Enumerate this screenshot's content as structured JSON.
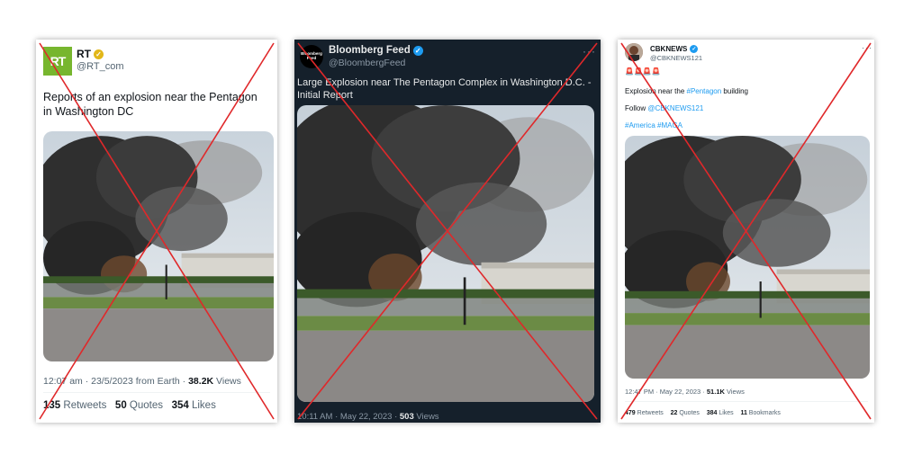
{
  "rt": {
    "name": "RT",
    "handle": "@RT_com",
    "logo_text": "RT",
    "text": "Reports of an explosion near the Pentagon in Washington DC",
    "time_date": "12:07 am · 23/5/2023 from Earth · ",
    "views_count": "38.2K",
    "views_label": " Views",
    "retweets_count": "135",
    "retweets_label": " Retweets",
    "quotes_count": "50",
    "quotes_label": " Quotes",
    "likes_count": "354",
    "likes_label": " Likes",
    "verified_color": "#e2b719"
  },
  "bloomberg": {
    "name": "Bloomberg Feed",
    "handle": "@BloombergFeed",
    "avatar_text": "Bloomberg Feed",
    "more": "···",
    "text": "Large Explosion near The Pentagon Complex in Washington D.C. - Initial Report",
    "time_date": "10:11 AM · May 22, 2023 · ",
    "views_count": "503",
    "views_label": " Views",
    "verified_color": "#1d9bf0"
  },
  "cbk": {
    "name": "CBKNEWS",
    "handle": "@CBKNEWS121",
    "more": "···",
    "emoji_row": "🚨🚨🚨🚨",
    "line1_prefix": "Explosion near the ",
    "line1_tag": "#Pentagon",
    "line1_suffix": " building",
    "line2_prefix": "Follow ",
    "line2_mention": "@CBKNEWS121",
    "line3_tags": "#America #MAGA",
    "time_date": "12:47 PM · May 22, 2023 · ",
    "views_count": "51.1K",
    "views_label": " Views",
    "retweets_count": "479",
    "retweets_label": " Retweets",
    "quotes_count": "22",
    "quotes_label": " Quotes",
    "likes_count": "384",
    "likes_label": " Likes",
    "bookmarks_count": "11",
    "bookmarks_label": " Bookmarks",
    "verified_color": "#1d9bf0"
  },
  "overlay": {
    "cross_color": "#e0282a"
  }
}
